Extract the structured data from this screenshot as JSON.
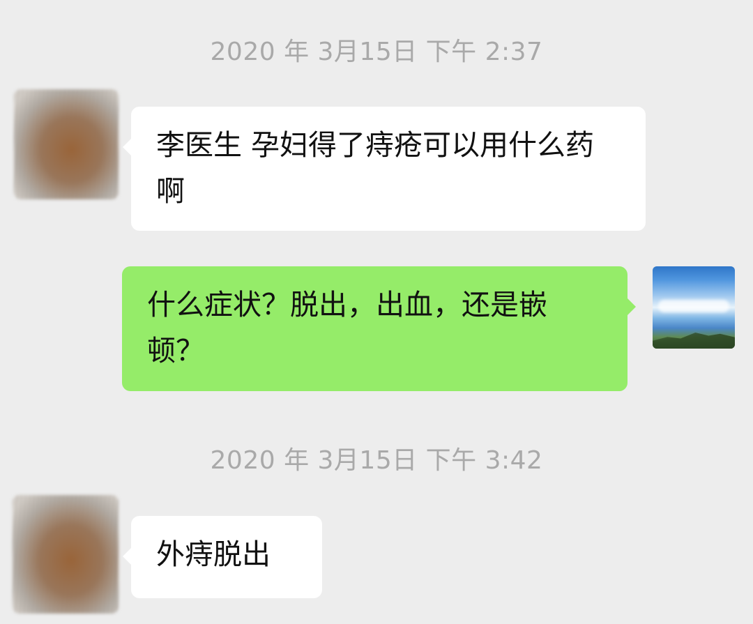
{
  "chat": {
    "groups": [
      {
        "timestamp": "2020 年 3月15日 下午 2:37",
        "messages": [
          {
            "sender": "doctor",
            "text": "李医生 孕妇得了痔疮可以用什么药啊"
          },
          {
            "sender": "me",
            "text": "什么症状？脱出，出血，还是嵌顿？"
          }
        ]
      },
      {
        "timestamp": "2020 年 3月15日 下午 3:42",
        "messages": [
          {
            "sender": "doctor",
            "text": "外痔脱出"
          }
        ]
      }
    ]
  },
  "colors": {
    "background": "#ededed",
    "incoming_bubble": "#ffffff",
    "outgoing_bubble": "#95ec69",
    "timestamp_text": "#a9a9a9"
  },
  "icons": {
    "doctor_avatar": "blurred-avatar-icon",
    "my_avatar": "mountain-landscape-avatar-icon"
  }
}
